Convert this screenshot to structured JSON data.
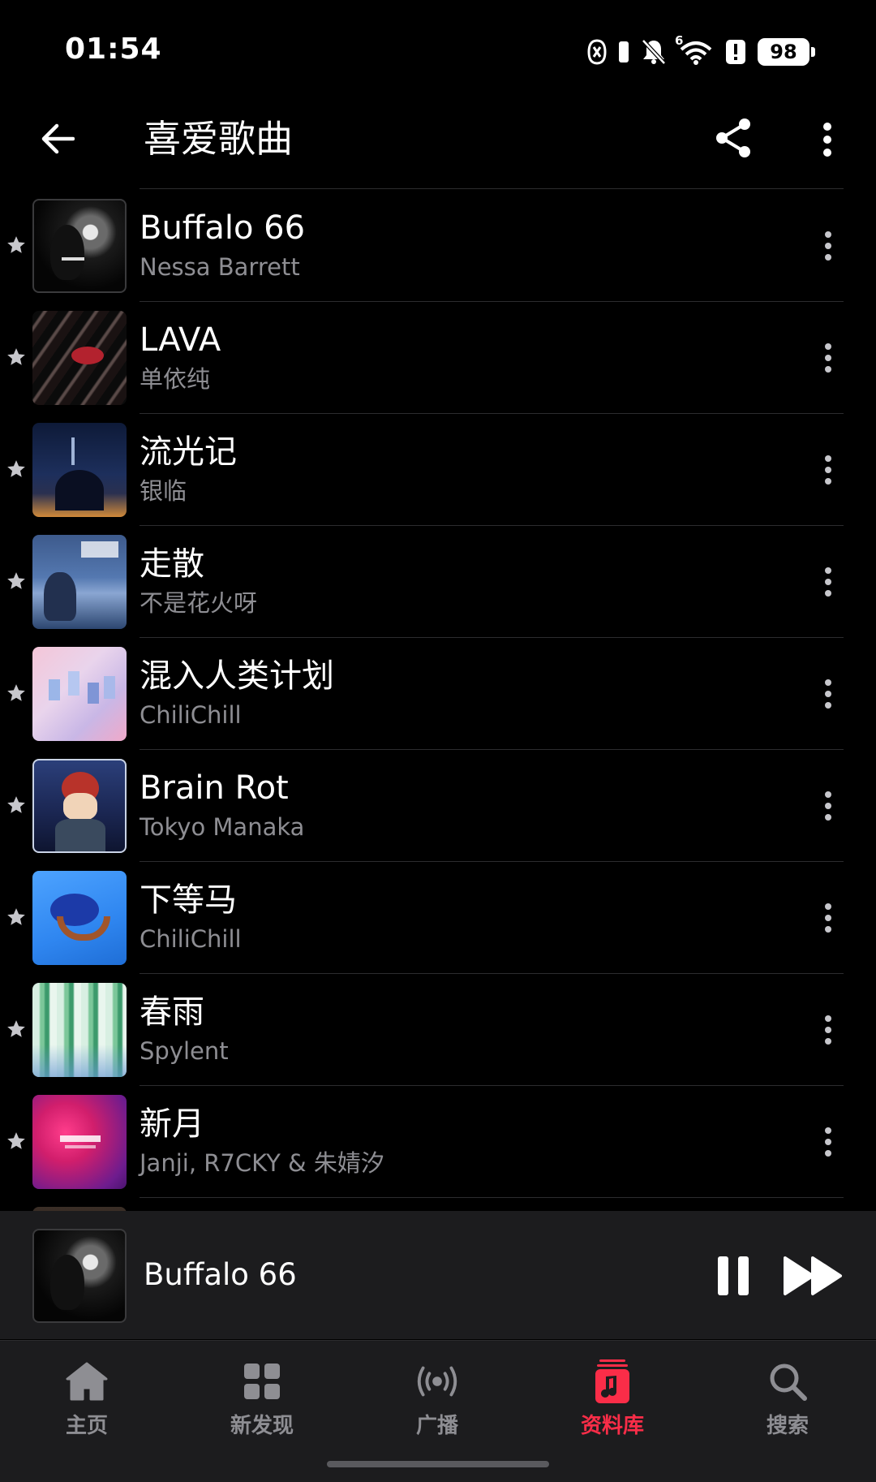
{
  "status_bar": {
    "time": "01:54",
    "battery": "98",
    "network": "6"
  },
  "header": {
    "title": "喜爱歌曲",
    "back_icon": "arrow-left-icon",
    "share_icon": "share-icon",
    "more_icon": "more-vertical-icon"
  },
  "songs": [
    {
      "title": "Buffalo 66",
      "artist": "Nessa Barrett",
      "favorite": true
    },
    {
      "title": "LAVA",
      "artist": "单依纯",
      "favorite": true
    },
    {
      "title": "流光记",
      "artist": "银临",
      "favorite": true
    },
    {
      "title": "走散",
      "artist": "不是花火呀",
      "favorite": true
    },
    {
      "title": "混入人类计划",
      "artist": "ChiliChill",
      "favorite": true
    },
    {
      "title": "Brain Rot",
      "artist": "Tokyo Manaka",
      "favorite": true
    },
    {
      "title": "下等马",
      "artist": "ChiliChill",
      "favorite": true
    },
    {
      "title": "春雨",
      "artist": "Spylent",
      "favorite": true
    },
    {
      "title": "新月",
      "artist": "Janji, R7CKY & 朱婧汐",
      "favorite": true
    },
    {
      "title": "",
      "artist": "",
      "favorite": false
    }
  ],
  "mini_player": {
    "title": "Buffalo 66",
    "state": "playing"
  },
  "tab_bar": {
    "tabs": [
      {
        "label": "主页",
        "icon": "home-icon",
        "active": false
      },
      {
        "label": "新发现",
        "icon": "grid-icon",
        "active": false
      },
      {
        "label": "广播",
        "icon": "radio-icon",
        "active": false
      },
      {
        "label": "资料库",
        "icon": "library-music-icon",
        "active": true
      },
      {
        "label": "搜索",
        "icon": "search-icon",
        "active": false
      }
    ]
  },
  "colors": {
    "accent": "#fa2d48",
    "secondary_text": "#8e8e93",
    "background": "#000000",
    "bar": "#1c1c1e"
  }
}
